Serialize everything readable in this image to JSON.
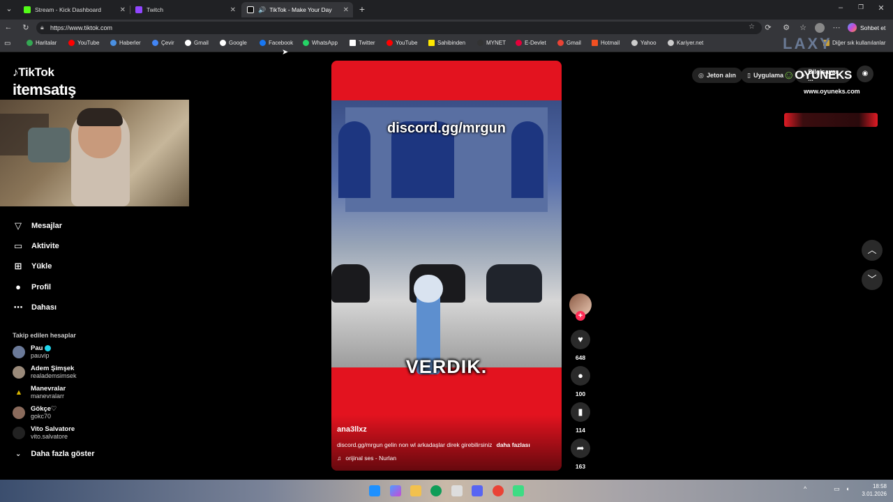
{
  "browser": {
    "tabs": [
      {
        "label": "Stream - Kick Dashboard",
        "icon": "kick-icon",
        "color": "#53fc18"
      },
      {
        "label": "Twitch",
        "icon": "twitch-icon",
        "color": "#9146ff"
      },
      {
        "label": "TikTok - Make Your Day",
        "icon": "tiktok-icon",
        "color": "#ffffff"
      }
    ],
    "url": "https://www.tiktok.com",
    "bookmarks": [
      {
        "label": "Haritalar",
        "icon": "maps-icon",
        "color": "#34a853"
      },
      {
        "label": "YouTube",
        "icon": "youtube-icon",
        "color": "#ff0000"
      },
      {
        "label": "Haberler",
        "icon": "news-icon",
        "color": "#4a90e2"
      },
      {
        "label": "Çevir",
        "icon": "translate-icon",
        "color": "#4285f4"
      },
      {
        "label": "Gmail",
        "icon": "google-icon",
        "color": "#ffffff"
      },
      {
        "label": "Google",
        "icon": "google-icon",
        "color": "#ffffff"
      },
      {
        "label": "Facebook",
        "icon": "facebook-icon",
        "color": "#1877f2"
      },
      {
        "label": "WhatsApp",
        "icon": "whatsapp-icon",
        "color": "#25d366"
      },
      {
        "label": "Twitter",
        "icon": "x-icon",
        "color": "#ffffff"
      },
      {
        "label": "YouTube",
        "icon": "youtube-icon",
        "color": "#ff0000"
      },
      {
        "label": "Sahibinden",
        "icon": "sahibinden-icon",
        "color": "#ffe800"
      },
      {
        "label": "MYNET",
        "icon": "mynet-icon",
        "color": "#333333"
      },
      {
        "label": "E-Devlet",
        "icon": "edevlet-icon",
        "color": "#e4003a"
      },
      {
        "label": "Gmail",
        "icon": "gmail-icon",
        "color": "#ea4335"
      },
      {
        "label": "Hotmail",
        "icon": "microsoft-icon",
        "color": "#f25022"
      },
      {
        "label": "Yahoo",
        "icon": "globe-icon",
        "color": "#cccccc"
      },
      {
        "label": "Kariyer.net",
        "icon": "globe-icon",
        "color": "#cccccc"
      }
    ],
    "other_bookmarks": "Diğer sık kullanılanlar",
    "copilot": "Sohbet et"
  },
  "tiktok": {
    "logo": "TikTok",
    "sponsor_logo": "itemsatış",
    "nav": [
      {
        "label": "Mesajlar",
        "icon": "send-icon"
      },
      {
        "label": "Aktivite",
        "icon": "activity-icon"
      },
      {
        "label": "Yükle",
        "icon": "upload-icon"
      },
      {
        "label": "Profil",
        "icon": "profile-icon"
      },
      {
        "label": "Dahası",
        "icon": "more-icon"
      }
    ],
    "following_title": "Takip edilen hesaplar",
    "following": [
      {
        "name": "Pau",
        "handle": "pauvip",
        "color": "#6b7a99"
      },
      {
        "name": "Adem Şimşek",
        "handle": "realademsimsek",
        "color": "#9a8a7a"
      },
      {
        "name": "Manevralar",
        "handle": "manevralarr",
        "color": "#d6b400"
      },
      {
        "name": "Gökçe♡",
        "handle": "gokc70",
        "color": "#8a6b5c"
      },
      {
        "name": "Vito Salvatore",
        "handle": "vito.salvatore",
        "color": "#333333"
      }
    ],
    "show_more": "Daha fazla göster",
    "video": {
      "overlay_top": "discord.gg/mrgun",
      "overlay_mid": "VERDIK.",
      "author": "ana3llxz",
      "caption": "discord.gg/mrgun gelin non wl arkadaşlar direk girebilirsiniz",
      "caption_more": "daha fazlası",
      "music": "orijinal ses - Nurlan"
    },
    "actions": {
      "likes": "648",
      "comments": "100",
      "saves": "114",
      "shares": "163"
    },
    "top_right": {
      "coins": "Jeton alın",
      "app": "Uygulama",
      "pc": "Bilgisayar ..."
    }
  },
  "overlays": {
    "oyuneks": "OYUNEKS",
    "oyuneks_url": "www.oyuneks.com",
    "laxy": "LAXY"
  },
  "taskbar": {
    "time": "18:58",
    "date": "3.01.2026"
  }
}
